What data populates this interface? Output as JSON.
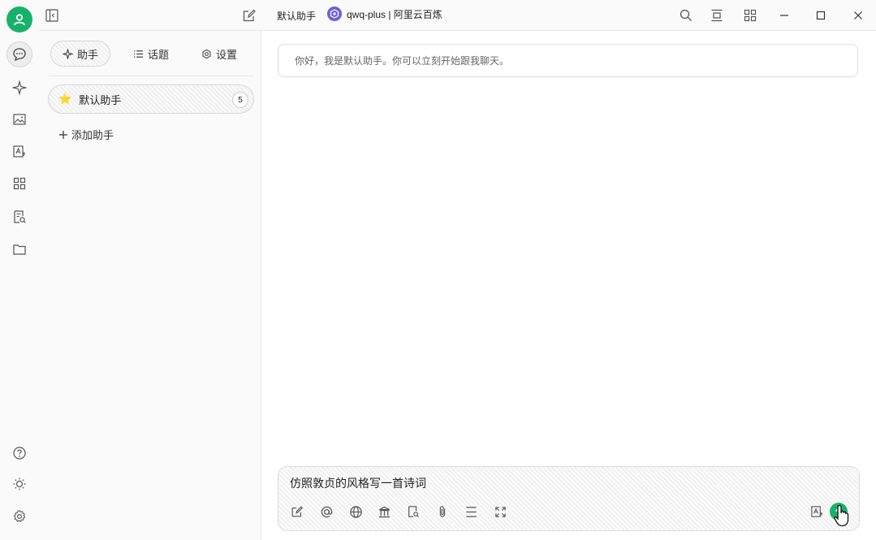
{
  "window": {
    "current_assistant_title": "默认助手",
    "model_label": "qwq-plus | 阿里云百炼"
  },
  "rail": {
    "items": [
      {
        "name": "chat",
        "icon": "chat-bubble-icon"
      },
      {
        "name": "agents",
        "icon": "sparkle-icon"
      },
      {
        "name": "paint",
        "icon": "image-icon"
      },
      {
        "name": "translate",
        "icon": "translate-icon"
      },
      {
        "name": "apps",
        "icon": "grid-icon"
      },
      {
        "name": "knowledge",
        "icon": "document-search-icon"
      },
      {
        "name": "files",
        "icon": "folder-icon"
      }
    ],
    "bottom": [
      {
        "name": "help",
        "icon": "help-icon"
      },
      {
        "name": "theme",
        "icon": "sun-icon"
      },
      {
        "name": "settings",
        "icon": "gear-icon"
      }
    ]
  },
  "panel": {
    "tabs": [
      {
        "label": "助手",
        "icon": "sparkle-icon",
        "active": true
      },
      {
        "label": "话题",
        "icon": "list-icon",
        "active": false
      },
      {
        "label": "设置",
        "icon": "gear-icon",
        "active": false
      }
    ],
    "assistants": [
      {
        "emoji": "⭐",
        "name": "默认助手",
        "count": "5"
      }
    ],
    "add_assistant_label": "添加助手"
  },
  "chat": {
    "welcome_message": "你好，我是默认助手。你可以立刻开始跟我聊天。",
    "input_value": "仿照敦贞的风格写一首诗词"
  },
  "colors": {
    "accent": "#17b26a",
    "model_logo": "#6c63d9"
  }
}
